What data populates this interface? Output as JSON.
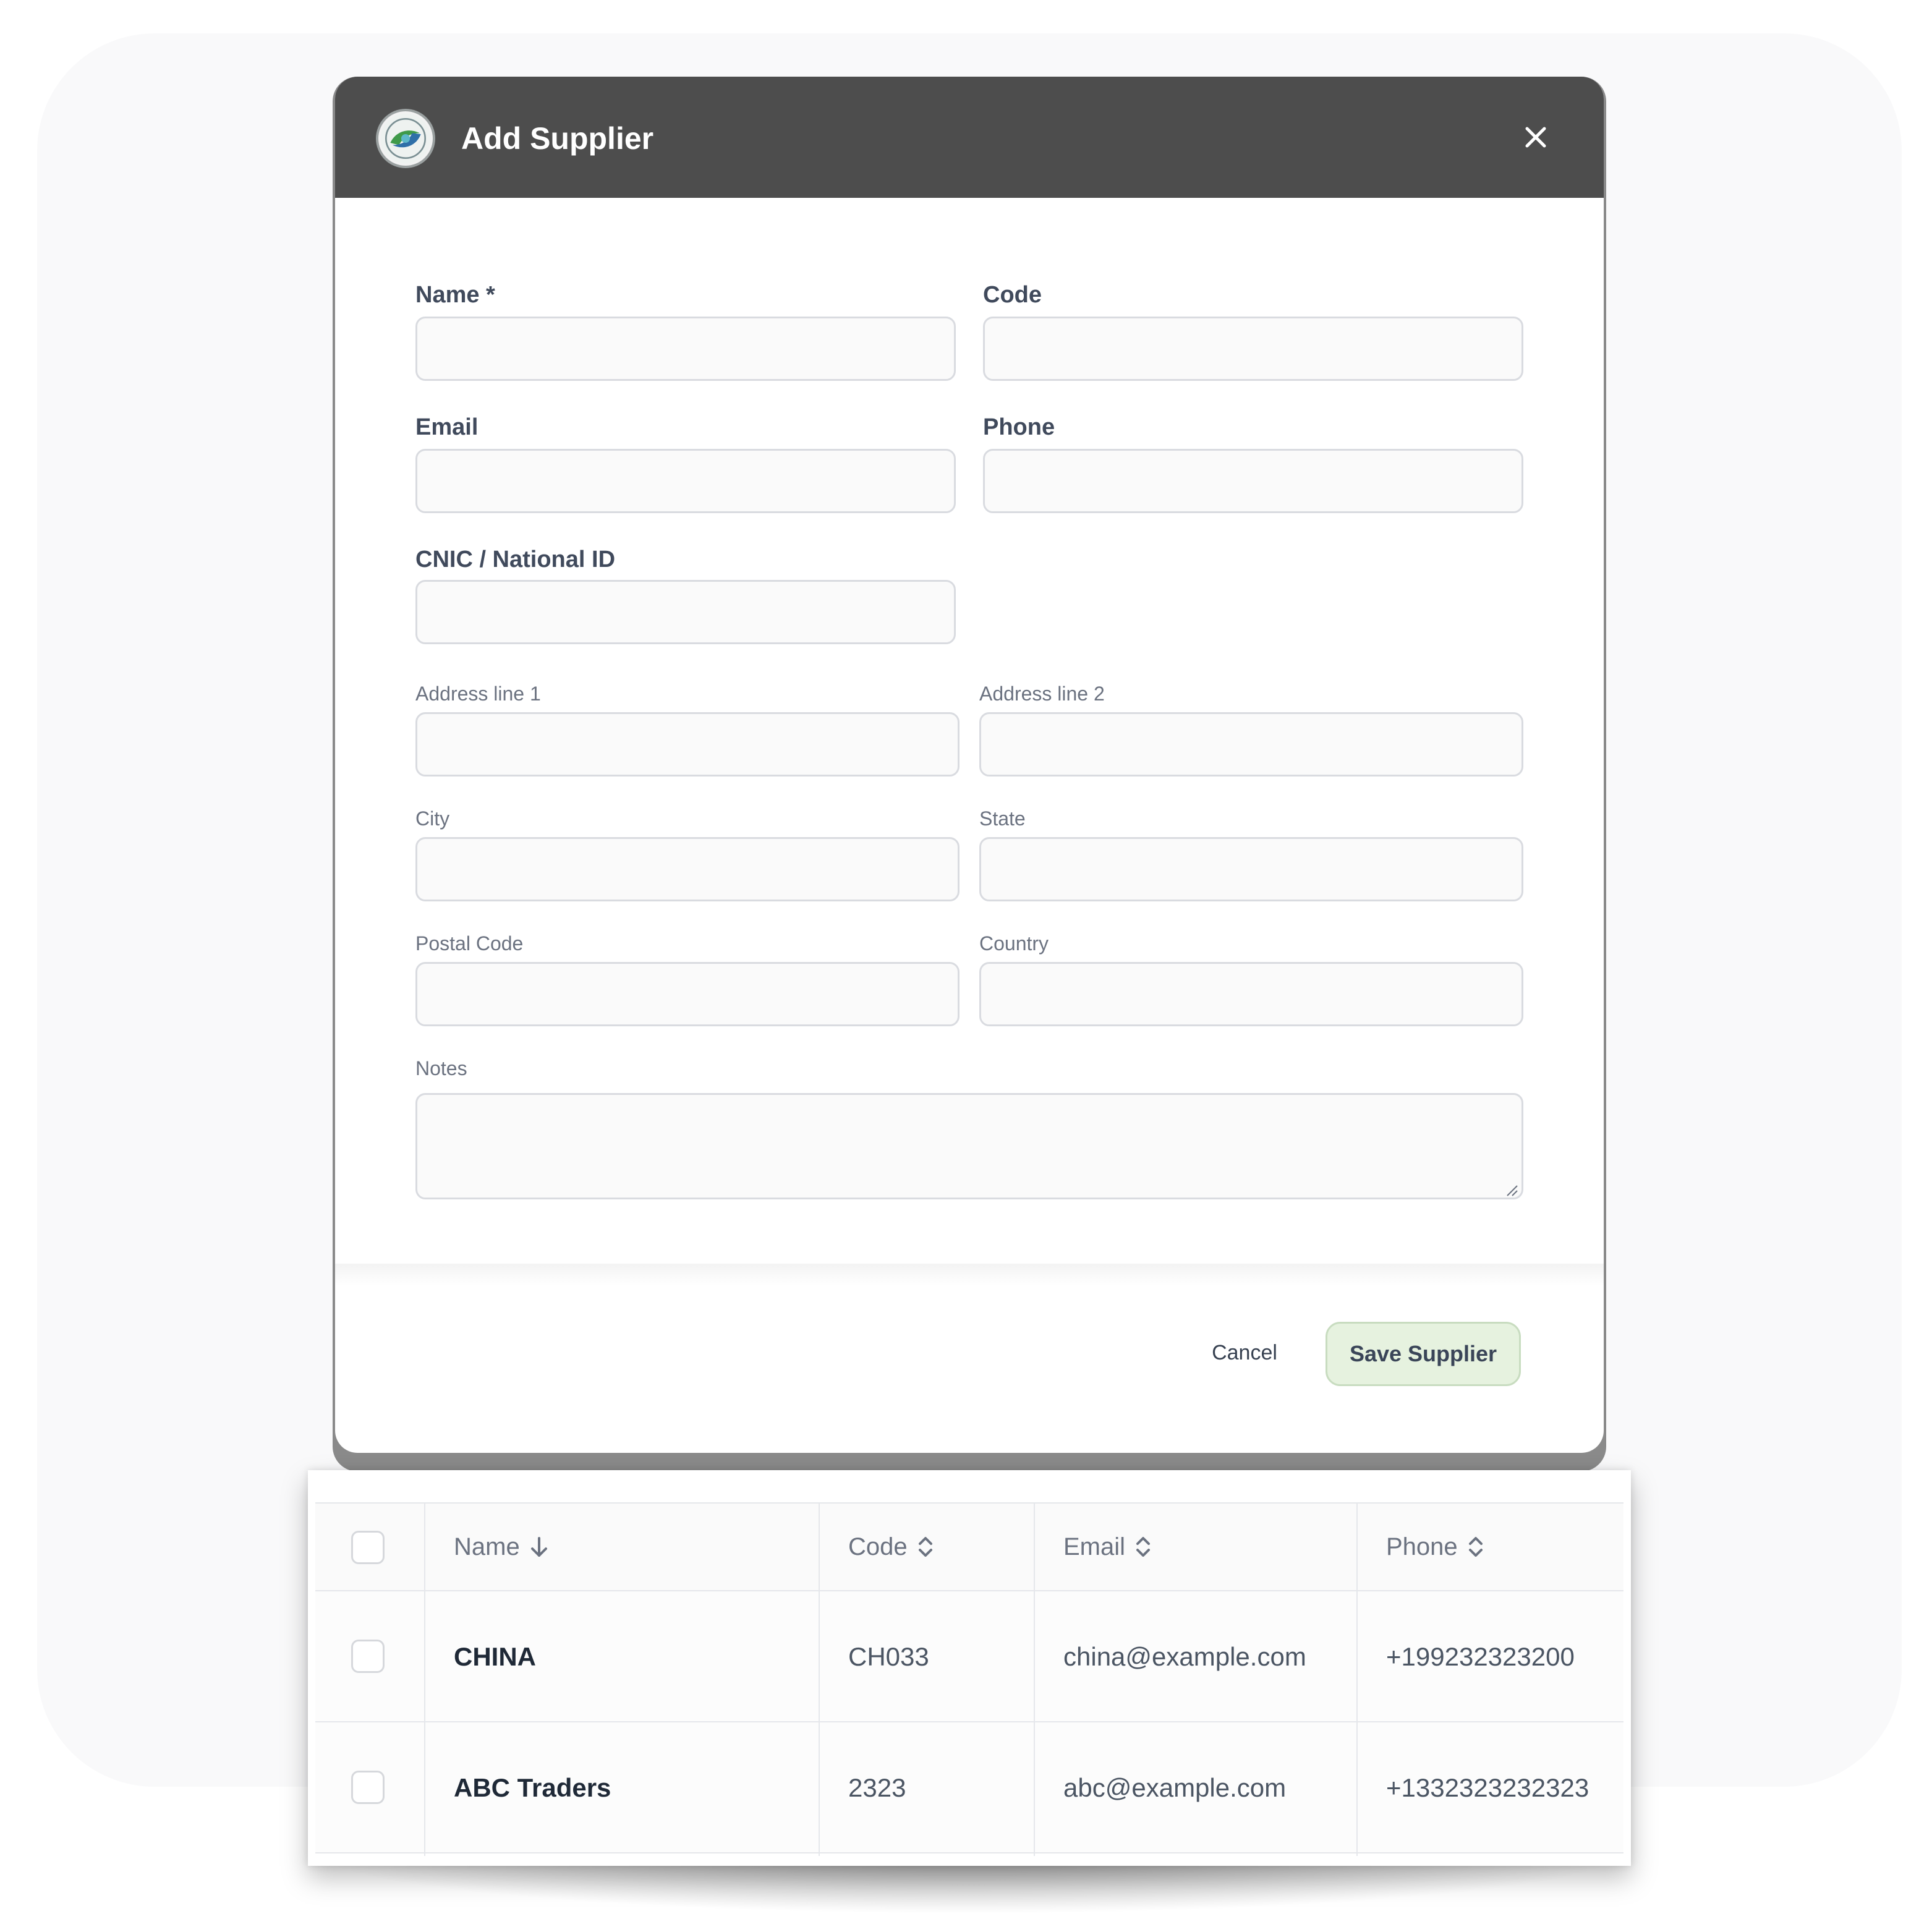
{
  "modal": {
    "title": "Add Supplier",
    "fields": {
      "name_label": "Name *",
      "code_label": "Code",
      "email_label": "Email",
      "phone_label": "Phone",
      "cnic_label": "CNIC / National ID",
      "address1_label": "Address line 1",
      "address2_label": "Address line 2",
      "city_label": "City",
      "state_label": "State",
      "postal_label": "Postal Code",
      "country_label": "Country",
      "notes_label": "Notes"
    },
    "cancel_label": "Cancel",
    "save_label": "Save Supplier",
    "colors": {
      "header_bg": "#4d4d4d",
      "save_bg": "#e6f2df"
    }
  },
  "table": {
    "columns": [
      {
        "label": "Name",
        "sort": "arrow-down-icon"
      },
      {
        "label": "Code",
        "sort": "sort-icon"
      },
      {
        "label": "Email",
        "sort": "sort-icon"
      },
      {
        "label": "Phone",
        "sort": "sort-icon"
      }
    ],
    "rows": [
      {
        "name": "CHINA",
        "code": "CH033",
        "email": "china@example.com",
        "phone": "+199232323200"
      },
      {
        "name": "ABC Traders",
        "code": "2323",
        "email": "abc@example.com",
        "phone": "+1332323232323"
      }
    ]
  }
}
